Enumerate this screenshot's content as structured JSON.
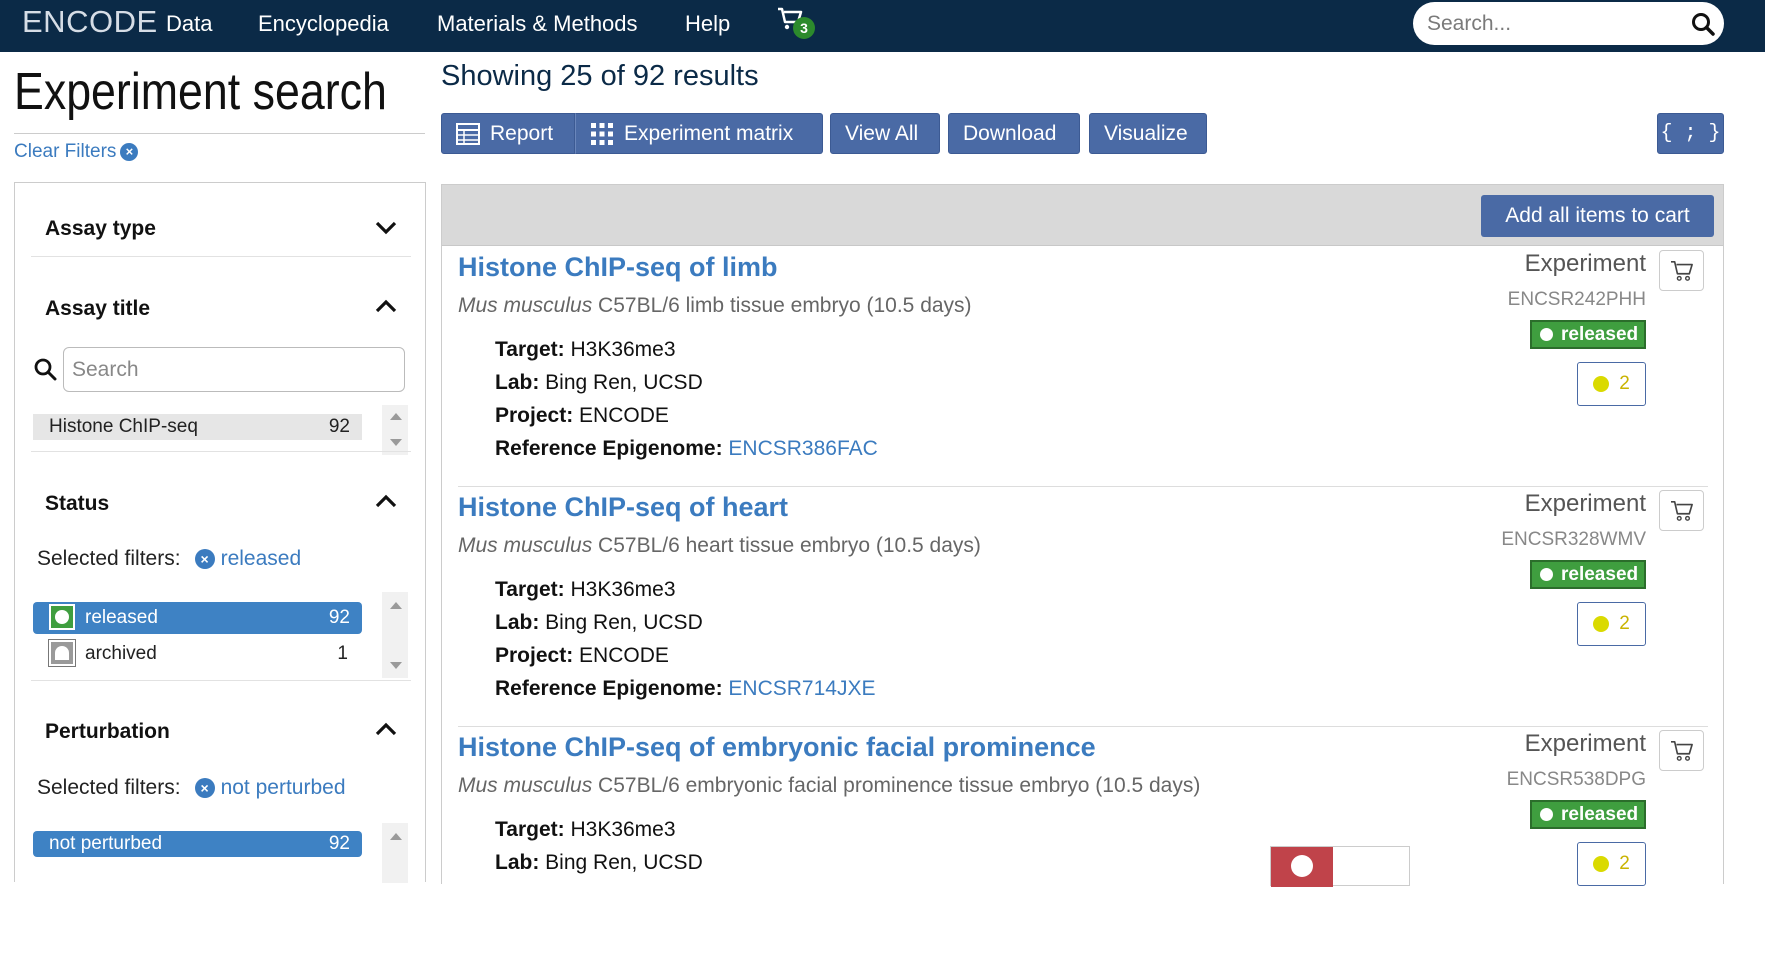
{
  "nav": {
    "brand": "ENCODE",
    "items": [
      "Data",
      "Encyclopedia",
      "Materials & Methods",
      "Help"
    ],
    "cart_count": "3",
    "search_placeholder": "Search..."
  },
  "sidebar": {
    "title": "Experiment search",
    "clear_filters": "Clear Filters",
    "facets": {
      "assay_type": {
        "label": "Assay type"
      },
      "assay_title": {
        "label": "Assay title",
        "search_placeholder": "Search",
        "terms": [
          {
            "label": "Histone ChIP-seq",
            "count": "92"
          }
        ]
      },
      "status": {
        "label": "Status",
        "selected_label": "Selected filters:",
        "selected": "released",
        "terms": [
          {
            "label": "released",
            "count": "92"
          },
          {
            "label": "archived",
            "count": "1"
          }
        ]
      },
      "perturbation": {
        "label": "Perturbation",
        "selected_label": "Selected filters:",
        "selected": "not perturbed",
        "terms": [
          {
            "label": "not perturbed",
            "count": "92"
          }
        ]
      }
    }
  },
  "main": {
    "results_count": "Showing 25 of 92 results",
    "buttons": {
      "report": "Report",
      "matrix": "Experiment matrix",
      "view_all": "View All",
      "download": "Download",
      "visualize": "Visualize",
      "json": "{ ; }"
    },
    "add_all": "Add all items to cart",
    "results": [
      {
        "title": "Histone ChIP-seq of limb",
        "organism": "Mus musculus",
        "biosample": "C57BL/6 limb tissue embryo (10.5 days)",
        "target_label": "Target:",
        "target": "H3K36me3",
        "lab_label": "Lab:",
        "lab": "Bing Ren, UCSD",
        "project_label": "Project:",
        "project": "ENCODE",
        "ref_label": "Reference Epigenome:",
        "ref": "ENCSR386FAC",
        "type": "Experiment",
        "accession": "ENCSR242PHH",
        "status": "released",
        "audit_count": "2"
      },
      {
        "title": "Histone ChIP-seq of heart",
        "organism": "Mus musculus",
        "biosample": "C57BL/6 heart tissue embryo (10.5 days)",
        "target_label": "Target:",
        "target": "H3K36me3",
        "lab_label": "Lab:",
        "lab": "Bing Ren, UCSD",
        "project_label": "Project:",
        "project": "ENCODE",
        "ref_label": "Reference Epigenome:",
        "ref": "ENCSR714JXE",
        "type": "Experiment",
        "accession": "ENCSR328WMV",
        "status": "released",
        "audit_count": "2"
      },
      {
        "title": "Histone ChIP-seq of embryonic facial prominence",
        "organism": "Mus musculus",
        "biosample": "C57BL/6 embryonic facial prominence tissue embryo (10.5 days)",
        "target_label": "Target:",
        "target": "H3K36me3",
        "lab_label": "Lab:",
        "lab": "Bing Ren, UCSD",
        "type": "Experiment",
        "accession": "ENCSR538DPG",
        "status": "released",
        "audit_count": "2"
      }
    ]
  },
  "colors": {
    "navbar": "#0b2a47",
    "link": "#3b7bbf",
    "button": "#4a6aa5",
    "released": "#3f9e3f",
    "selected_term": "#3e82c4",
    "audit_warning": "#dada00"
  },
  "icons": {
    "cart": "cart-icon",
    "search": "search-icon",
    "chevron": "chevron-icon",
    "clear": "close-circle-icon",
    "table": "table-icon",
    "grid": "grid-icon"
  }
}
